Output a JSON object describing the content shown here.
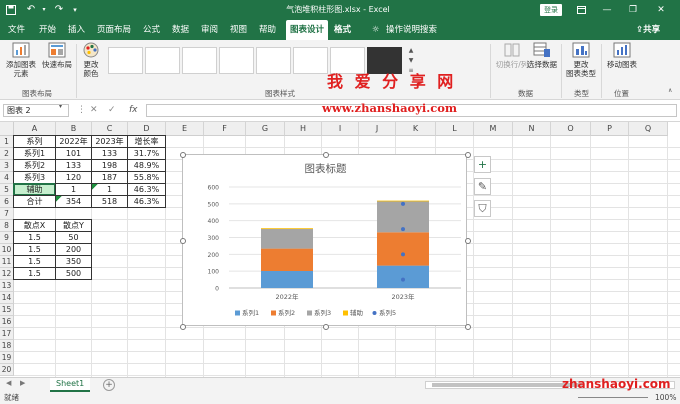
{
  "titlebar": {
    "file_title": "气泡堆积柱形图.xlsx - Excel",
    "save_icon": "save-icon",
    "undo_icon": "undo-icon",
    "redo_icon": "redo-icon",
    "login_label": "登录",
    "minimize": "—",
    "restore": "❐",
    "close": "✕"
  },
  "tabs": [
    "文件",
    "开始",
    "插入",
    "页面布局",
    "公式",
    "数据",
    "审阅",
    "视图",
    "帮助",
    "图表设计",
    "格式"
  ],
  "active_tab": "图表设计",
  "tell_me": "操作说明搜索",
  "share": "共享",
  "ribbon": {
    "add_element_l1": "添加图表",
    "add_element_l2": "元素",
    "quick_layout": "快速布局",
    "change_colors_l1": "更改",
    "change_colors_l2": "颜色",
    "group_layout": "图表布局",
    "group_styles": "图表样式",
    "switch_row_col": "切换行/列",
    "select_data": "选择数据",
    "group_data": "数据",
    "change_type_l1": "更改",
    "change_type_l2": "图表类型",
    "group_type": "类型",
    "move_chart": "移动图表",
    "group_location": "位置"
  },
  "watermark": {
    "cn": "我 爱 分 享 网",
    "url": "www.zhanshaoyi.com",
    "url2": "zhanshaoyi.com"
  },
  "formula": {
    "name_box": "图表 2",
    "cancel": "✕",
    "enter": "✓",
    "fx": "fx",
    "value": ""
  },
  "columns": [
    "A",
    "B",
    "C",
    "D",
    "E",
    "F",
    "G",
    "H",
    "I",
    "J",
    "K",
    "L",
    "M",
    "N",
    "O",
    "P",
    "Q"
  ],
  "rows": [
    "1",
    "2",
    "3",
    "4",
    "5",
    "6",
    "7",
    "8",
    "9",
    "10",
    "11",
    "12",
    "13",
    "14",
    "15",
    "16",
    "17",
    "18",
    "19",
    "20"
  ],
  "table1": {
    "header": [
      "系列",
      "2022年",
      "2023年",
      "增长率"
    ],
    "rows": [
      [
        "系列1",
        "101",
        "133",
        "31.7%"
      ],
      [
        "系列2",
        "133",
        "198",
        "48.9%"
      ],
      [
        "系列3",
        "120",
        "187",
        "55.8%"
      ],
      [
        "辅助",
        "1",
        "1",
        "46.3%"
      ],
      [
        "合计",
        "354",
        "518",
        "46.3%"
      ]
    ]
  },
  "table2": {
    "header": [
      "散点X",
      "散点Y"
    ],
    "rows": [
      [
        "1.5",
        "50"
      ],
      [
        "1.5",
        "200"
      ],
      [
        "1.5",
        "350"
      ],
      [
        "1.5",
        "500"
      ]
    ]
  },
  "chart_data": {
    "type": "bar",
    "title": "图表标题",
    "categories": [
      "2022年",
      "2023年"
    ],
    "stacked": true,
    "ylim": [
      0,
      600
    ],
    "yticks": [
      "0",
      "100",
      "200",
      "300",
      "400",
      "500",
      "600"
    ],
    "series": [
      {
        "name": "系列1",
        "values": [
          101,
          133
        ],
        "color": "#5b9bd5"
      },
      {
        "name": "系列2",
        "values": [
          133,
          198
        ],
        "color": "#ed7d31"
      },
      {
        "name": "系列3",
        "values": [
          120,
          187
        ],
        "color": "#a5a5a5"
      },
      {
        "name": "辅助",
        "values": [
          1,
          1
        ],
        "color": "#ffc000"
      }
    ],
    "scatter": {
      "name": "系列5",
      "x": [
        1.5,
        1.5,
        1.5,
        1.5
      ],
      "y": [
        50,
        200,
        350,
        500
      ],
      "color": "#4472c4"
    },
    "grid": true,
    "legend": "bottom"
  },
  "sheet": {
    "tab": "Sheet1",
    "add": "+",
    "prev": "◀",
    "next": "▶"
  },
  "status": {
    "ready": "就绪",
    "zoom": "100%"
  },
  "theme": {
    "accent": "#217346"
  }
}
